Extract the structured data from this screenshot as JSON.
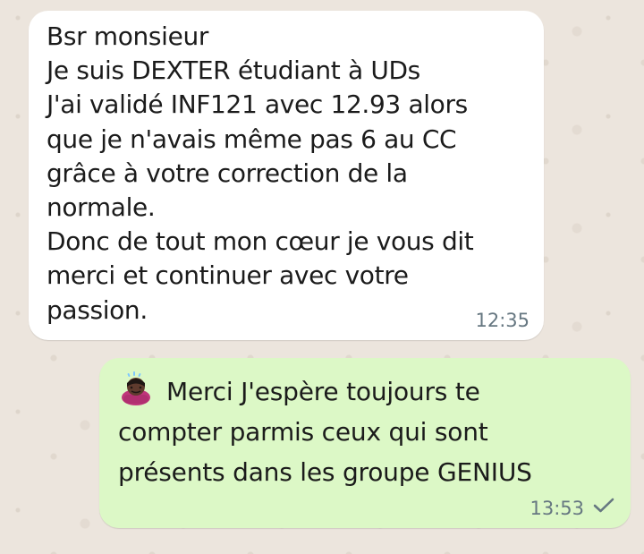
{
  "conversation": {
    "messages": [
      {
        "direction": "incoming",
        "text": "Bsr monsieur\nJe suis DEXTER étudiant à UDs\nJ'ai validé INF121 avec 12.93 alors\nque je n'avais même pas 6 au CC\ngrâce à votre correction de la\nnormale.\nDonc de tout mon cœur je vous dit\nmerci et continuer avec votre\npassion.",
        "time": "12:35"
      },
      {
        "direction": "outgoing",
        "emoji_icon": "man-bowing-emoji",
        "text": "Merci J'espère toujours te\ncompter parmis ceux qui sont\nprésents dans les groupe GENIUS",
        "time": "13:53",
        "status_icon": "single-check-icon"
      }
    ]
  },
  "colors": {
    "chat_background": "#ece5dd",
    "incoming_bubble": "#ffffff",
    "outgoing_bubble": "#dcf8c6",
    "meta_text": "#667781"
  }
}
